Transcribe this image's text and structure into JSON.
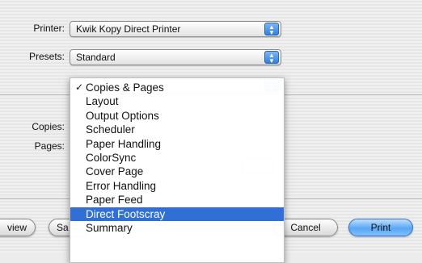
{
  "printer": {
    "label": "Printer:",
    "value": "Kwik Kopy Direct Printer"
  },
  "presets": {
    "label": "Presets:",
    "value": "Standard"
  },
  "copies_label": "Copies:",
  "pages_label": "Pages:",
  "menu": {
    "checked_index": 0,
    "selected_index": 10,
    "items": [
      "Copies & Pages",
      "Layout",
      "Output Options",
      "Scheduler",
      "Paper Handling",
      "ColorSync",
      "Cover Page",
      "Error Handling",
      "Paper Feed",
      "Direct Footscray",
      "Summary"
    ]
  },
  "buttons": {
    "preview_partial": "view",
    "save_partial": "Sa",
    "cancel": "Cancel",
    "print": "Print"
  },
  "colors": {
    "accent": "#2f6fd6",
    "default_button": "#5aa7f5"
  }
}
